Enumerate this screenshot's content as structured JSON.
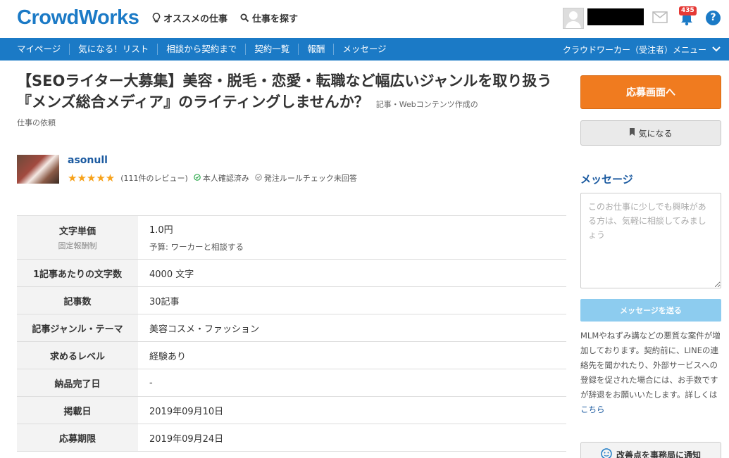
{
  "header": {
    "logo": "CrowdWorks",
    "nav": [
      {
        "label": "オススメの仕事",
        "icon": "lightbulb-icon"
      },
      {
        "label": "仕事を探す",
        "icon": "search-icon"
      }
    ],
    "notification_count": "435",
    "help_label": "?"
  },
  "navbar": {
    "links": [
      "マイページ",
      "気になる！リスト",
      "相談から契約まで",
      "契約一覧",
      "報酬",
      "メッセージ"
    ],
    "menu_right": "クラウドワーカー（受注者）メニュー"
  },
  "job": {
    "title": "【SEOライター大募集】美容・脱毛・恋愛・転職など幅広いジャンルを取り扱う『メンズ総合メディア』のライティングしませんか？",
    "category": "記事・Webコンテンツ作成の",
    "category_suffix": "仕事の依頼"
  },
  "client": {
    "name": "asonull",
    "stars": "★★★★★",
    "reviews": "(111件のレビュー)",
    "identity": "本人確認済み",
    "rule_check": "発注ルールチェック未回答"
  },
  "details": [
    {
      "label": "文字単価",
      "sub_label": "固定報酬制",
      "value": "1.0円",
      "sub_value": "予算: ワーカーと相談する"
    },
    {
      "label": "1記事あたりの文字数",
      "value": "4000 文字"
    },
    {
      "label": "記事数",
      "value": "30記事"
    },
    {
      "label": "記事ジャンル・テーマ",
      "value": "美容コスメ・ファッション"
    },
    {
      "label": "求めるレベル",
      "value": "経験あり"
    },
    {
      "label": "納品完了日",
      "value": "-"
    },
    {
      "label": "掲載日",
      "value": "2019年09月10日"
    },
    {
      "label": "応募期限",
      "value": "2019年09月24日"
    }
  ],
  "sidebar": {
    "apply_label": "応募画面へ",
    "favorite_label": "気になる",
    "message_heading": "メッセージ",
    "message_placeholder": "このお仕事に少しでも興味がある方は、気軽に相談してみましょう",
    "send_label": "メッセージを送る",
    "notice": "MLMやねずみ講などの悪質な案件が増加しております。契約前に、LINEの連絡先を聞かれたり、外部サービスへの登録を促された場合には、お手数ですが辞退をお願いいたします。詳しくは",
    "notice_link": "こちら",
    "report_label": "改善点を事務局に通知"
  },
  "colors": {
    "brand": "#1b7ac6",
    "apply": "#f07b1f",
    "send": "#8dccef",
    "stars": "#f7a21b"
  }
}
